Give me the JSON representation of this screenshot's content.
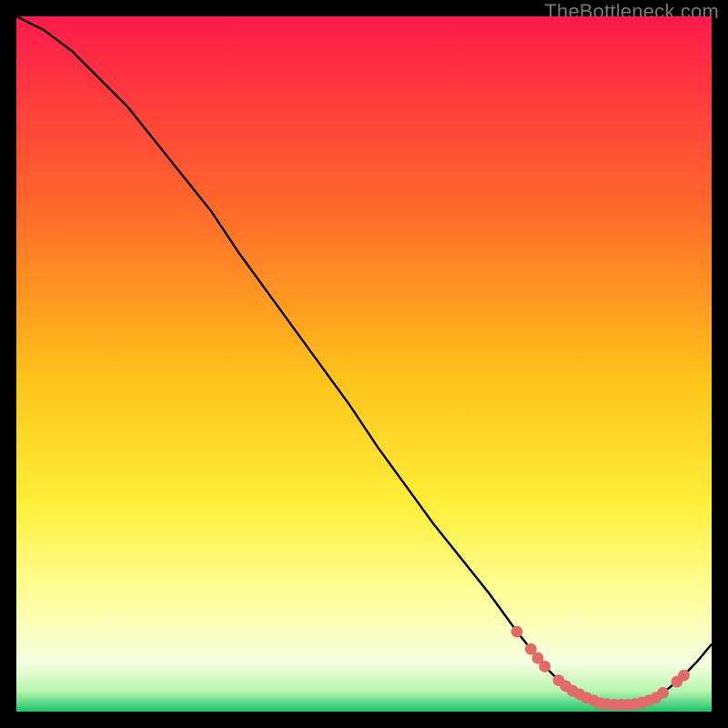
{
  "watermark": "TheBottleneck.com",
  "colors": {
    "background": "#000000",
    "gradient_top": "#ff1a4b",
    "gradient_mid_upper": "#ff7a2a",
    "gradient_mid": "#ffd21a",
    "gradient_mid_lower": "#ffff66",
    "gradient_lower": "#f8ffd0",
    "gradient_bottom": "#19c46a",
    "curve": "#000000",
    "dot": "#e46a6a"
  },
  "chart_data": {
    "type": "line",
    "title": "",
    "xlabel": "",
    "ylabel": "",
    "xlim": [
      0,
      100
    ],
    "ylim": [
      0,
      100
    ],
    "series": [
      {
        "name": "bottleneck-curve",
        "x": [
          0,
          4,
          8,
          12,
          16,
          20,
          24,
          28,
          32,
          36,
          40,
          44,
          48,
          52,
          56,
          60,
          64,
          68,
          72,
          74,
          76,
          78,
          80,
          82,
          84,
          86,
          88,
          90,
          92,
          94,
          96,
          98,
          100
        ],
        "y": [
          100,
          98,
          95,
          91,
          87,
          82,
          77,
          72,
          66,
          60.5,
          55,
          49.5,
          44,
          38,
          32.5,
          27,
          22,
          17,
          11.5,
          9,
          6.5,
          4.5,
          3,
          2,
          1.2,
          1,
          1,
          1.3,
          2,
          3.5,
          5.2,
          7.3,
          9.7
        ]
      }
    ],
    "dots": {
      "name": "highlight-dots",
      "x": [
        72,
        74,
        75,
        76,
        78,
        79,
        80,
        81,
        82,
        83,
        84,
        85,
        86,
        87,
        88,
        89,
        90,
        91,
        92,
        93,
        95,
        96
      ],
      "y": [
        11.5,
        9,
        7.7,
        6.5,
        4.5,
        3.7,
        3,
        2.5,
        2,
        1.6,
        1.2,
        1.1,
        1,
        1,
        1,
        1.1,
        1.3,
        1.6,
        2,
        2.7,
        4.3,
        5.2
      ]
    }
  }
}
